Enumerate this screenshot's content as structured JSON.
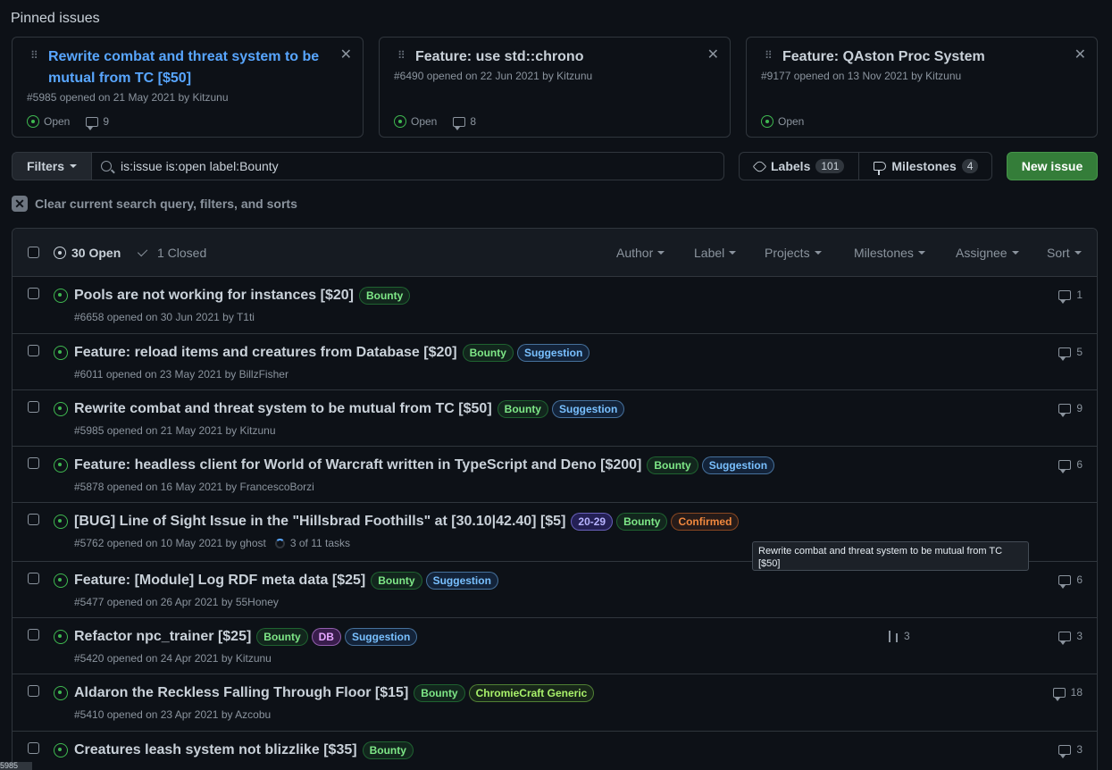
{
  "pinned": {
    "heading": "Pinned issues",
    "cards": [
      {
        "title": "Rewrite combat and threat system to be mutual from TC [$50]",
        "meta": "#5985 opened on 21 May 2021 by Kitzunu",
        "state": "Open",
        "comments": "9"
      },
      {
        "title": "Feature: use std::chrono",
        "meta": "#6490 opened on 22 Jun 2021 by Kitzunu",
        "state": "Open",
        "comments": "8"
      },
      {
        "title": "Feature: QAston Proc System",
        "meta": "#9177 opened on 13 Nov 2021 by Kitzunu",
        "state": "Open",
        "comments": ""
      }
    ]
  },
  "toolbar": {
    "filters_label": "Filters",
    "search_value": "is:issue is:open label:Bounty",
    "labels_label": "Labels",
    "labels_count": "101",
    "milestones_label": "Milestones",
    "milestones_count": "4",
    "new_issue_label": "New issue"
  },
  "clear_filters": "Clear current search query, filters, and sorts",
  "list_header": {
    "open_label": "30 Open",
    "closed_label": "1 Closed",
    "filters": [
      "Author",
      "Label",
      "Projects",
      "Milestones",
      "Assignee",
      "Sort"
    ]
  },
  "issues": [
    {
      "title": "Pools are not working for instances [$20]",
      "meta": "#6658 opened on 30 Jun 2021 by T1ti",
      "comments": "1"
    },
    {
      "title": "Feature: reload items and creatures from Database [$20]",
      "meta": "#6011 opened on 23 May 2021 by BillzFisher",
      "comments": "5"
    },
    {
      "title": "Rewrite combat and threat system to be mutual from TC [$50]",
      "meta": "#5985 opened on 21 May 2021 by Kitzunu",
      "comments": "9"
    },
    {
      "title": "Feature: headless client for World of Warcraft written in TypeScript and Deno [$200]",
      "meta": "#5878 opened on 16 May 2021 by FrancescoBorzi",
      "comments": "6"
    },
    {
      "title": "[BUG] Line of Sight Issue in the \"Hillsbrad Foothills\" at [30.10|42.40] [$5]",
      "meta": "#5762 opened on 10 May 2021 by ghost",
      "tasks": "3 of 11 tasks",
      "comments": ""
    },
    {
      "title": "Feature: [Module] Log RDF meta data [$25]",
      "meta": "#5477 opened on 26 Apr 2021 by 55Honey",
      "comments": "6"
    },
    {
      "title": "Refactor npc_trainer [$25]",
      "meta": "#5420 opened on 24 Apr 2021 by Kitzunu",
      "prs": "3",
      "comments": "3"
    },
    {
      "title": "Aldaron the Reckless Falling Through Floor [$15]",
      "meta": "#5410 opened on 23 Apr 2021 by Azcobu",
      "comments": "18"
    },
    {
      "title": "Creatures leash system not blizzlike [$35]",
      "meta": "",
      "comments": "3"
    }
  ],
  "labels": {
    "bounty": "Bounty",
    "suggestion": "Suggestion",
    "range": "20-29",
    "confirmed": "Confirmed",
    "db": "DB",
    "chromie": "ChromieCraft Generic"
  },
  "tooltip": "Rewrite combat and threat system to be mutual from TC [$50]",
  "corner_tag": "5985",
  "colors": {
    "background": "#0d1117",
    "link": "#58a6ff",
    "open_green": "#3fb950",
    "primary_button": "#347d39"
  }
}
